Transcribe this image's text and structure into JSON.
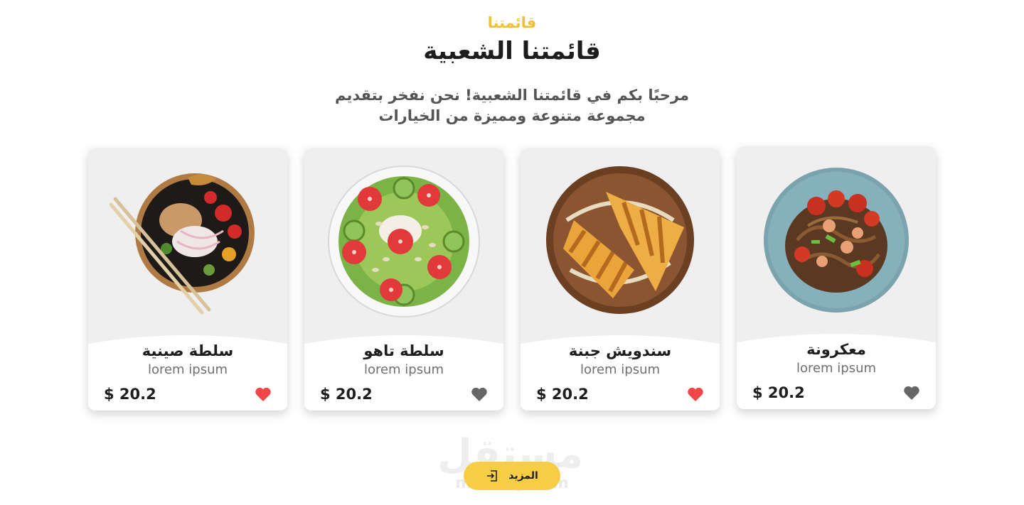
{
  "section": {
    "eyebrow": "قائمتنا",
    "title": "قائمتنا الشعبية",
    "subtitle_line1": "مرحبًا بكم في قائمتنا الشعبية! نحن نفخر بتقديم",
    "subtitle_line2": "مجموعة متنوعة ومميزة من الخيارات"
  },
  "cards": [
    {
      "name": "معكرونة",
      "desc": "lorem ipsum",
      "price": "$ 20.2",
      "favorite": false,
      "heart_color": "#666666",
      "icon": "heart-icon"
    },
    {
      "name": "سندويش جبنة",
      "desc": "lorem ipsum",
      "price": "$ 20.2",
      "favorite": true,
      "heart_color": "#f04848",
      "icon": "heart-icon"
    },
    {
      "name": "سلطة تاهو",
      "desc": "lorem ipsum",
      "price": "$ 20.2",
      "favorite": false,
      "heart_color": "#666666",
      "icon": "heart-icon"
    },
    {
      "name": "سلطة صينية",
      "desc": "lorem ipsum",
      "price": "$ 20.2",
      "favorite": true,
      "heart_color": "#f04848",
      "icon": "heart-icon"
    }
  ],
  "more_button": {
    "label": "المزيد",
    "icon": "login-arrow-icon"
  },
  "watermark": {
    "text": "مستقل",
    "sub": "mostaql.com"
  },
  "colors": {
    "accent": "#f2c037",
    "button": "#f7cd45",
    "heart_active": "#f04848",
    "heart_inactive": "#666666"
  }
}
